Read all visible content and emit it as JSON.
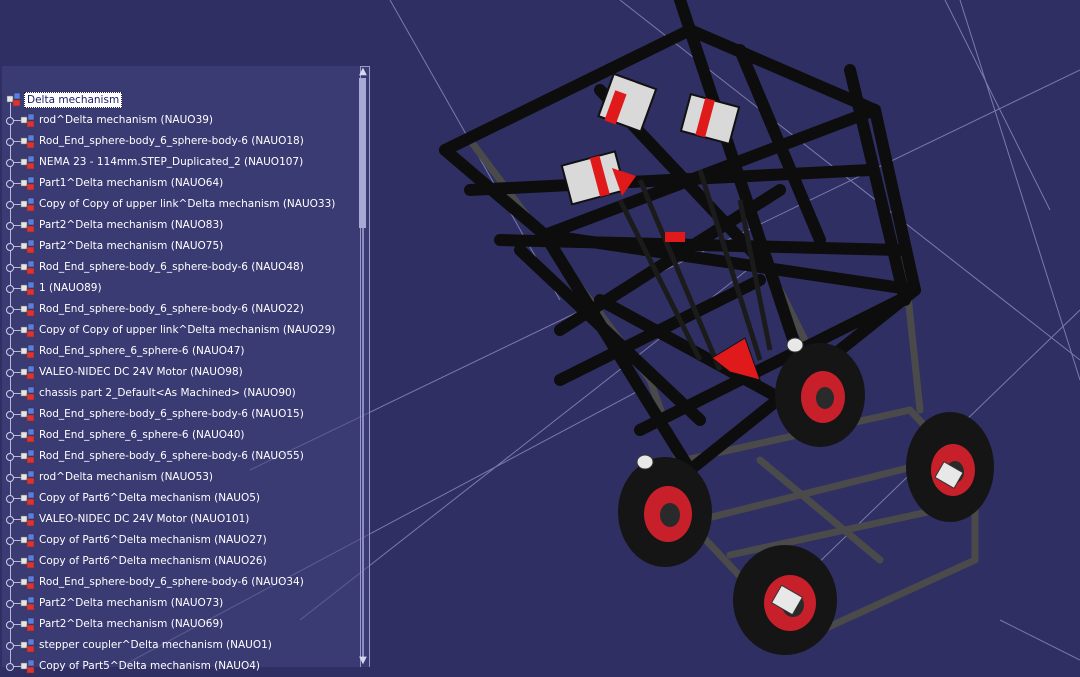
{
  "tree": {
    "root": "Delta mechanism",
    "items": [
      "rod^Delta mechanism (NAUO39)",
      "Rod_End_sphere-body_6_sphere-body-6 (NAUO18)",
      "NEMA 23 - 114mm.STEP_Duplicated_2 (NAUO107)",
      "Part1^Delta mechanism (NAUO64)",
      "Copy of Copy of upper link^Delta mechanism (NAUO33)",
      "Part2^Delta mechanism (NAUO83)",
      "Part2^Delta mechanism (NAUO75)",
      "Rod_End_sphere-body_6_sphere-body-6 (NAUO48)",
      "1 (NAUO89)",
      "Rod_End_sphere-body_6_sphere-body-6 (NAUO22)",
      "Copy of Copy of upper link^Delta mechanism (NAUO29)",
      "Rod_End_sphere_6_sphere-6 (NAUO47)",
      "VALEO-NIDEC DC 24V Motor (NAUO98)",
      "chassis part 2_Default<As Machined> (NAUO90)",
      "Rod_End_sphere-body_6_sphere-body-6 (NAUO15)",
      "Rod_End_sphere_6_sphere-6 (NAUO40)",
      "Rod_End_sphere-body_6_sphere-body-6 (NAUO55)",
      "rod^Delta mechanism (NAUO53)",
      "Copy of Part6^Delta mechanism (NAUO5)",
      "VALEO-NIDEC DC 24V Motor (NAUO101)",
      "Copy of Part6^Delta mechanism (NAUO27)",
      "Copy of Part6^Delta mechanism (NAUO26)",
      "Rod_End_sphere-body_6_sphere-body-6 (NAUO34)",
      "Part2^Delta mechanism (NAUO73)",
      "Part2^Delta mechanism (NAUO69)",
      "stepper coupler^Delta mechanism (NAUO1)",
      "Copy of Part5^Delta mechanism (NAUO4)"
    ],
    "item_icon": "part-icon",
    "root_icon": "assembly-icon"
  },
  "scrollbar": {
    "up_arrow": "▲",
    "down_arrow": "▼"
  },
  "colors": {
    "background": "#2f2f64",
    "frame": "#111111",
    "wheel_rim": "#c8202a",
    "motor_red": "#e01a1a"
  }
}
